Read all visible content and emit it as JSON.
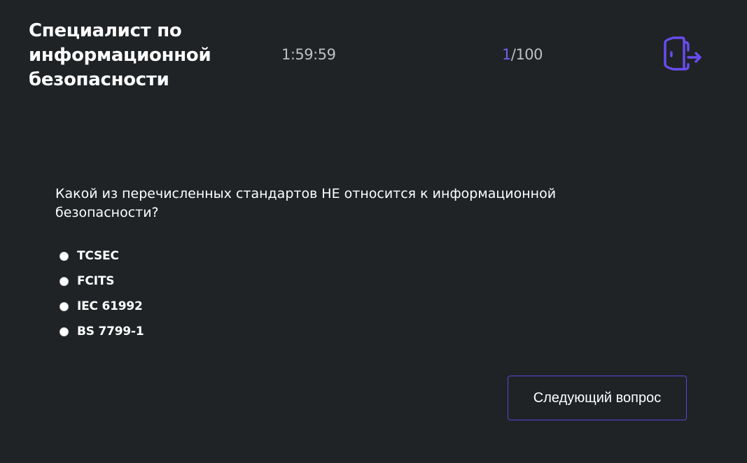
{
  "header": {
    "title": "Специалист по информационной безопасности",
    "timer": "1:59:59",
    "progress": {
      "current": "1",
      "separator_total": "/100"
    },
    "exit_icon": "exit-door-icon"
  },
  "quiz": {
    "question": "Какой из перечисленных стандартов НЕ относится к информационной безопасности?",
    "options": [
      {
        "label": "TCSEC",
        "selected": false
      },
      {
        "label": "FCITS",
        "selected": false
      },
      {
        "label": "IEC 61992",
        "selected": false
      },
      {
        "label": "BS 7799-1",
        "selected": false
      }
    ],
    "next_label": "Следующий вопрос"
  },
  "colors": {
    "background": "#1f2326",
    "accent": "#6a4cf0",
    "text": "#ffffff",
    "muted_text": "#bfbfbf"
  }
}
